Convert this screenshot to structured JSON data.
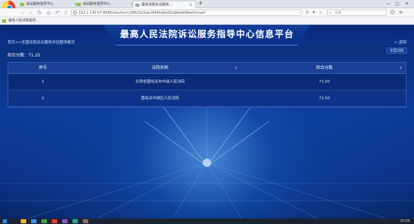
{
  "browser": {
    "tabs": [
      {
        "label": "诉讼服务指导中心",
        "active": false
      },
      {
        "label": "诉讼服务指导中心",
        "active": false
      },
      {
        "label": "最高法院诉讼服务…",
        "active": true
      }
    ],
    "url": "192.1.140.67:8080/sfzx/form/58620a5de29994d9af92a8bddd9ba0/insert",
    "search_placeholder": "百度",
    "bookmark": "最高人民法院指导…"
  },
  "page": {
    "title": "最高人民法院诉讼服务指导中心信息平台",
    "breadcrumb_home": "首页",
    "breadcrumb_rest": ">>全国法院诉讼服务评估整体概况",
    "back_label": "返回",
    "hospital_btn": "全国法院",
    "score_label": "综合分数：71.25"
  },
  "table": {
    "headers": [
      "序号",
      "法院名称",
      "综合分数"
    ],
    "rows": [
      [
        "1",
        "甘肃省嘉峪关市中级人民法院",
        "71.00"
      ],
      [
        "2",
        "嘉峪关市城区人民法院",
        "71.50"
      ]
    ]
  },
  "taskbar": {
    "time": "10:56"
  },
  "colors": {
    "accent": "#0b2c74",
    "header_text": "#ffffff"
  }
}
